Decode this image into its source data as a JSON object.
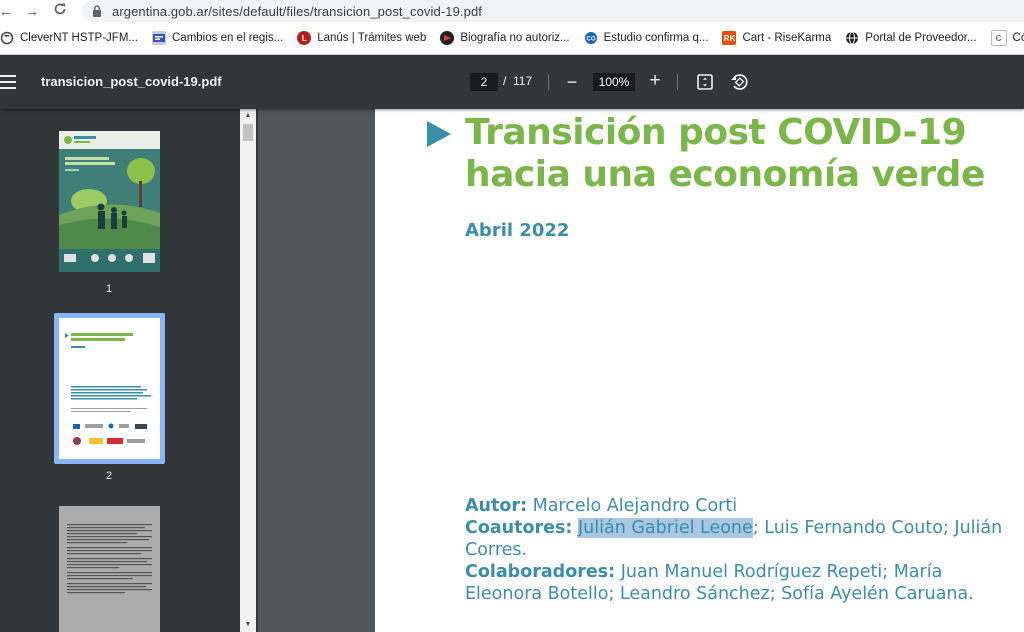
{
  "browser": {
    "url": "argentina.gob.ar/sites/default/files/transicion_post_covid-19.pdf",
    "bookmarks": [
      {
        "label": "CleverNT HSTP-JFM...",
        "icon": "cleverNT-icon",
        "color": "#4a4a4a"
      },
      {
        "label": "Cambios en el regis...",
        "icon": "registry-icon",
        "color": "#3f51b5"
      },
      {
        "label": "Lanús | Trámites web",
        "icon": "lanus-icon",
        "color": "#b71c1c"
      },
      {
        "label": "Biografía no autoriz...",
        "icon": "news-icon",
        "color": "#212121"
      },
      {
        "label": "Estudio confirma q...",
        "icon": "study-icon",
        "color": "#1565c0"
      },
      {
        "label": "Cart - RiseKarma",
        "icon": "risekarma-icon",
        "color": "#e65100",
        "badge": "RK"
      },
      {
        "label": "Portal de Proveedor...",
        "icon": "globe-icon",
        "color": "#202124"
      },
      {
        "label": "Cómo m",
        "icon": "c-icon",
        "color": "#9e9e9e",
        "badge": "C"
      }
    ]
  },
  "toolbar": {
    "doc_title": "transicion_post_covid-19.pdf",
    "page_current": "2",
    "page_sep": "/",
    "page_total": "117",
    "zoom": "100%",
    "zoom_out": "−",
    "zoom_in": "+"
  },
  "thumbnails": [
    {
      "number": "1"
    },
    {
      "number": "2"
    }
  ],
  "document": {
    "title_line1": "Transición post COVID-19",
    "title_line2": "hacia una economía verde",
    "date": "Abril 2022",
    "author_label": "Autor:",
    "author": "Marcelo Alejandro Corti",
    "coauthors_label": "Coautores:",
    "coauthor_highlighted": "Julián Gabriel Leone",
    "coauthors_rest": "; Luis Fernando Couto; Julián Corres.",
    "collaborators_label": "Colaboradores:",
    "collaborators": "Juan Manuel Rodríguez Repeti; María Eleonora Botello; Leandro Sánchez; Sofía Ayelén Caruana."
  },
  "colors": {
    "title_green": "#7ab648",
    "accent_blue": "#3a8ea9",
    "toolbar_bg": "#323639",
    "viewer_bg": "#525659",
    "selection": "#a8c7e5"
  }
}
